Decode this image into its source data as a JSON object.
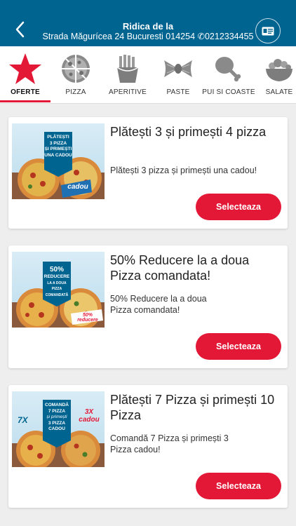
{
  "header": {
    "title": "Ridica de la",
    "address": "Strada Măgurícea 24 Bucuresti 014254 ✆0212334455"
  },
  "categories": [
    {
      "label": "OFERTE",
      "icon": "star-icon",
      "active": true
    },
    {
      "label": "PIZZA",
      "icon": "pizza-icon",
      "active": false
    },
    {
      "label": "APERITIVE",
      "icon": "fries-icon",
      "active": false
    },
    {
      "label": "PASTE",
      "icon": "pasta-icon",
      "active": false
    },
    {
      "label": "PUI SI COASTE",
      "icon": "chicken-leg-icon",
      "active": false
    },
    {
      "label": "SALATE",
      "icon": "salad-bowl-icon",
      "active": false
    }
  ],
  "offers": [
    {
      "title": "Plătești 3 și primești 4 pizza",
      "description": "Plătești 3 pizza și primești una cadou!",
      "button": "Selecteaza",
      "image_banner": [
        "PLĂTEȘTI",
        "3 PIZZA",
        "ȘI PRIMEȘTI",
        "UNA CADOU"
      ],
      "image_badge": "cadou"
    },
    {
      "title": "50% Reducere la a doua Pizza comandata!",
      "description": "50% Reducere la a doua Pizza comandata!",
      "button": "Selecteaza",
      "image_banner": [
        "50%",
        "REDUCERE",
        "LA A DOUA PIZZA",
        "COMANDATĂ"
      ],
      "image_badge": "50% reducere"
    },
    {
      "title": "Plătești 7 Pizza și primești 10 Pizza",
      "description": "Comandă 7 Pizza și primești 3 Pizza cadou!",
      "button": "Selecteaza",
      "image_banner": [
        "COMANDĂ",
        "7 PIZZA",
        "și primești",
        "3 PIZZA",
        "CADOU"
      ],
      "image_badge": "3X cadou",
      "image_left_badge": "7X"
    }
  ],
  "colors": {
    "header_bg": "#006491",
    "accent_red": "#e31837",
    "page_bg": "#eeeeee"
  }
}
